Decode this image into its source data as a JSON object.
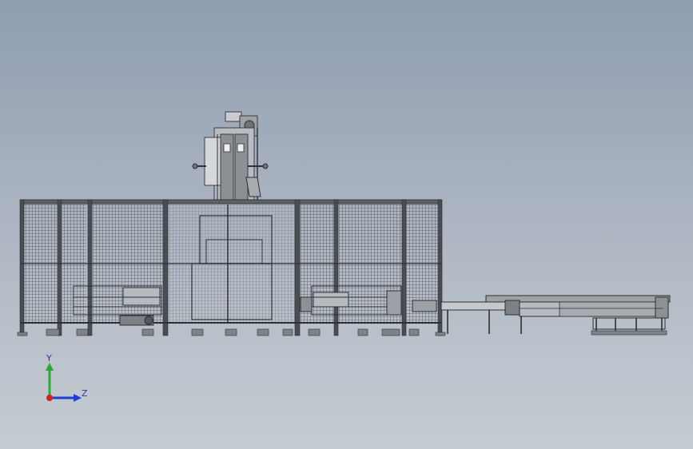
{
  "triad": {
    "y_label": "Y",
    "z_label": "Z",
    "y_color": "#2fa63a",
    "z_color": "#1c3fd2",
    "origin_color": "#d2211c"
  },
  "colors": {
    "steel": "#5d6065",
    "steel_dark": "#3b3d41",
    "steel_light": "#b4b7bb",
    "mesh": "#4a4d52"
  }
}
